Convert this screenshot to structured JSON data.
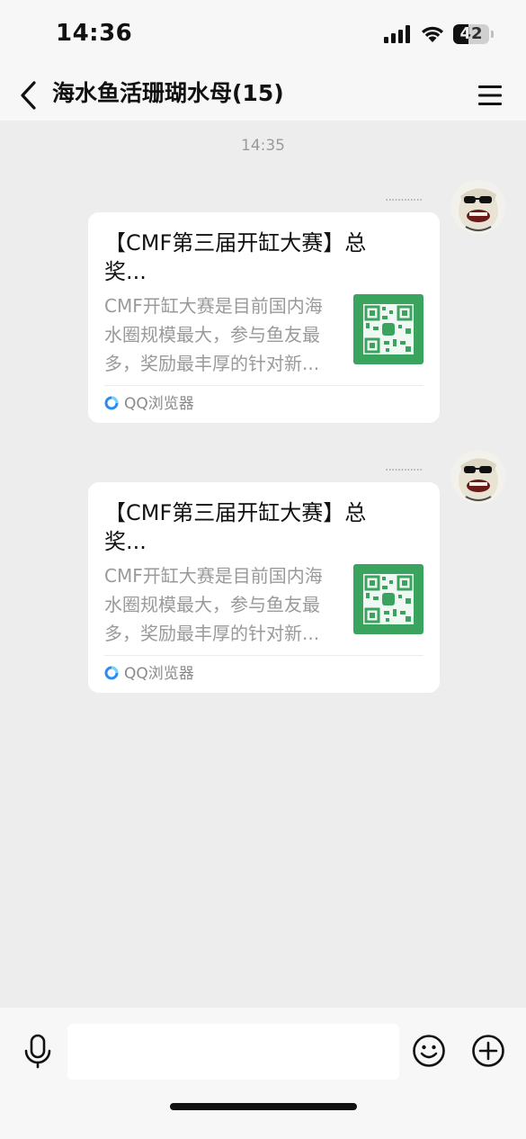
{
  "status_bar": {
    "time": "14:36",
    "battery_level": "42",
    "battery_fraction": 0.42,
    "icons": [
      "signal-icon",
      "wifi-icon",
      "battery-icon"
    ]
  },
  "nav": {
    "title": "海水鱼活珊瑚水母(15)",
    "back_icon": "chevron-left-icon",
    "menu_icon": "hamburger-menu-icon"
  },
  "chat": {
    "timestamp": "14:35",
    "messages": [
      {
        "sender": "............",
        "card": {
          "title": "【CMF第三届开缸大赛】总奖...",
          "description": "CMF开缸大赛是目前国内海\n水圈规模最大，参与鱼友最\n多，奖励最丰厚的针对新...",
          "source": "QQ浏览器",
          "thumbnail": "qr-code-image"
        }
      },
      {
        "sender": "............",
        "card": {
          "title": "【CMF第三届开缸大赛】总奖...",
          "description": "CMF开缸大赛是目前国内海\n水圈规模最大，参与鱼友最\n多，奖励最丰厚的针对新...",
          "source": "QQ浏览器",
          "thumbnail": "qr-code-image"
        }
      }
    ]
  },
  "input_bar": {
    "value": "",
    "icons": [
      "microphone-icon",
      "emoji-icon",
      "plus-circle-icon"
    ]
  },
  "colors": {
    "background": "#ededed",
    "bar": "#f7f7f7",
    "card": "#ffffff",
    "qr_green": "#3aa35d",
    "secondary_text": "#9a9a9a"
  }
}
